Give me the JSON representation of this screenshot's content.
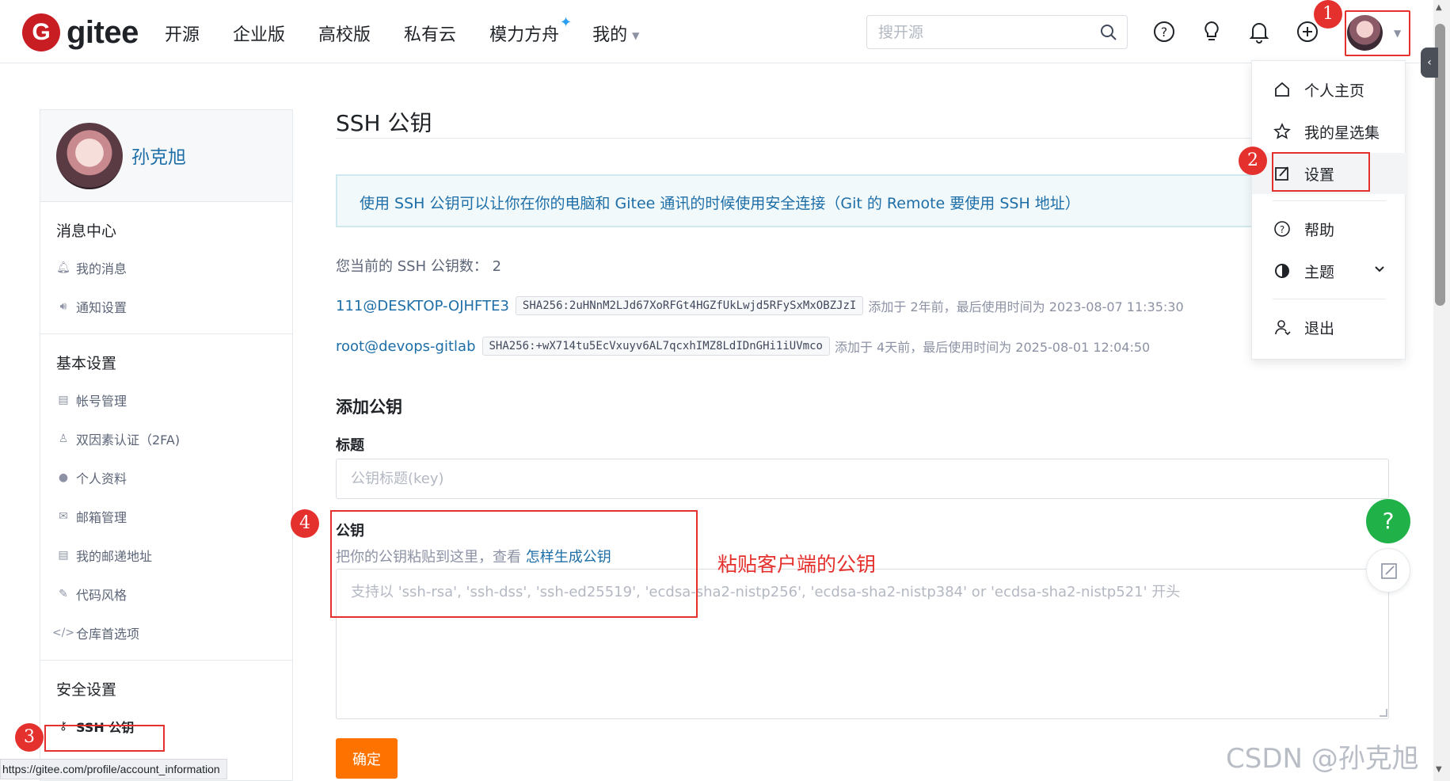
{
  "brand": {
    "logo_letter": "G",
    "name": "gitee",
    "color": "#c71d23"
  },
  "nav": {
    "items": [
      "开源",
      "企业版",
      "高校版",
      "私有云",
      "模力方舟",
      "我的"
    ],
    "spark_glyph": "✦"
  },
  "search": {
    "placeholder": "搜开源"
  },
  "toolbar": {
    "icons": [
      "help-icon",
      "lightbulb-icon",
      "bell-icon",
      "plus-circle-icon",
      "avatar"
    ]
  },
  "markers": [
    "1",
    "2",
    "3",
    "4"
  ],
  "sidebar": {
    "username": "孙克旭",
    "sections": [
      {
        "title": "消息中心",
        "items": [
          "我的消息",
          "通知设置"
        ]
      },
      {
        "title": "基本设置",
        "items": [
          "帐号管理",
          "双因素认证（2FA)",
          "个人资料",
          "邮箱管理",
          "我的邮递地址",
          "代码风格",
          "仓库首选项"
        ]
      },
      {
        "title": "安全设置",
        "items": [
          "SSH 公钥"
        ]
      }
    ]
  },
  "status_url": "https://gitee.com/profile/account_information",
  "main": {
    "title": "SSH 公钥",
    "info": "使用 SSH 公钥可以让你在你的电脑和 Gitee 通讯的时候使用安全连接（Git 的 Remote 要使用 SSH 地址）",
    "key_count_label": "您当前的 SSH 公钥数：",
    "key_count": "2",
    "keys": [
      {
        "name": "111@DESKTOP-OJHFTE3",
        "fingerprint": "SHA256:2uHNnM2LJd67XoRFGt4HGZfUkLwjd5RFySxMxOBZJzI",
        "meta": "添加于 2年前，最后使用时间为 2023-08-07 11:35:30"
      },
      {
        "name": "root@devops-gitlab",
        "fingerprint": "SHA256:+wX714tu5EcVxuyv6AL7qcxhIMZ8LdIDnGHi1iUVmco",
        "meta": "添加于 4天前，最后使用时间为 2025-08-01 12:04:50"
      }
    ],
    "add_title": "添加公钥",
    "title_label": "标题",
    "title_placeholder": "公钥标题(key)",
    "key_label": "公钥",
    "key_hint": "把你的公钥粘贴到这里，查看 ",
    "key_hint_link": "怎样生成公钥",
    "key_placeholder": "支持以 'ssh-rsa', 'ssh-dss', 'ssh-ed25519', 'ecdsa-sha2-nistp256', 'ecdsa-sha2-nistp384' or 'ecdsa-sha2-nistp521' 开头",
    "annotation": "粘贴客户端的公钥",
    "confirm": "确定"
  },
  "dropdown": {
    "items": [
      "个人主页",
      "我的星选集",
      "设置",
      "帮助",
      "主题",
      "退出"
    ],
    "highlighted": "设置"
  },
  "fab": {
    "help": "?"
  },
  "watermark": "CSDN @孙克旭",
  "colors": {
    "accent_blue": "#1e6ea7",
    "marker_red": "#e5312e",
    "confirm_orange": "#fe7300",
    "help_green": "#21b149"
  }
}
